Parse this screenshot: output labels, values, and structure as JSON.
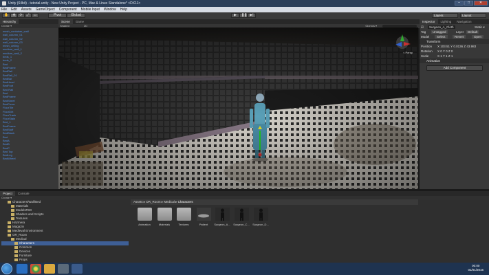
{
  "window": {
    "title": "Unity (64bit) - tutorial.unity - New Unity Project - PC, Mac & Linux Standalone* <DX11>",
    "controls": [
      "–",
      "□",
      "✕"
    ]
  },
  "menu": [
    "File",
    "Edit",
    "Assets",
    "GameObject",
    "Component",
    "Mobile Input",
    "Window",
    "Help"
  ],
  "toolbar": {
    "tools": [
      "✋",
      "✥",
      "⟳",
      "⤢",
      "▭"
    ],
    "pivot": "Pivot",
    "space": "Global",
    "play": "▶",
    "pause": "❚❚",
    "step": "▶|",
    "layers": "Layers",
    "layout": "Layout"
  },
  "hierarchy": {
    "tab": "Hierarchy",
    "create": "Create ▾",
    "items": [
      "mesh_container_wall",
      "wall_column_01",
      "wall_column_02",
      "wall_column_03",
      "mesh_ceiling",
      "medium_wall_1",
      "medium_wall_2",
      "beds_1",
      "beds_2",
      "Bed",
      "BedFrame",
      "BedRail",
      "BedRail_01",
      "BedBar",
      "BedHead",
      "BedFoot",
      "Bed Rail",
      "Bed",
      "BedFrame",
      "BedSheet",
      "BedCover",
      "FloorTile",
      "FloorDirt",
      "FloorTrash",
      "FloorStain",
      "Bed_1",
      "BedFrame",
      "BedStuff",
      "BedBlank",
      "Bed",
      "BedA",
      "BedB",
      "BedC",
      "Bed Top",
      "BedLeg",
      "BedWheel"
    ]
  },
  "scene": {
    "tabs": [
      "Scene",
      "Game"
    ],
    "shading": "Shaded",
    "mode": "2D",
    "gizmos": "Gizmos ▾",
    "persp": "< Persp"
  },
  "inspector": {
    "tabs": [
      "Inspector",
      "Lighting",
      "Navigation"
    ],
    "object_name": "Surgeon_A_Cloth",
    "static": "Static ▾",
    "tag_label": "Tag",
    "tag_value": "Untagged",
    "layer_label": "Layer",
    "layer_value": "Default",
    "model_label": "Model",
    "model_buttons": [
      "Select",
      "Revert",
      "Open"
    ],
    "transform": "Transform",
    "position_label": "Position",
    "position": "X 103.51  Y 0.0136  Z 43.983",
    "rotation_label": "Rotation",
    "rotation": "X 0      Y 0        Z 0",
    "scale_label": "Scale",
    "scale": "X 1      Y 1        Z 1",
    "animation": "Animation",
    "add_component": "Add Component"
  },
  "project": {
    "tabs": [
      "Project",
      "Console"
    ],
    "create": "Create ▾",
    "tree": [
      {
        "label": "Characters/Wall/Bed",
        "indent": 1
      },
      {
        "label": "Materials",
        "indent": 2
      },
      {
        "label": "ModelsFBX",
        "indent": 2
      },
      {
        "label": "Shaders and Scripts",
        "indent": 2
      },
      {
        "label": "Textures",
        "indent": 2
      },
      {
        "label": "Hazmera",
        "indent": 1
      },
      {
        "label": "Magazin",
        "indent": 1
      },
      {
        "label": "Medieval Environment",
        "indent": 1
      },
      {
        "label": "OR_Room",
        "indent": 1
      },
      {
        "label": "Medical",
        "indent": 2
      },
      {
        "label": "Characters",
        "indent": 3,
        "selected": true
      },
      {
        "label": "Common",
        "indent": 3
      },
      {
        "label": "Devices",
        "indent": 3
      },
      {
        "label": "Furniture",
        "indent": 3
      },
      {
        "label": "Props",
        "indent": 3
      }
    ],
    "breadcrumb": [
      "Assets",
      "OR_Room",
      "Medical",
      "Characters"
    ],
    "assets": [
      {
        "label": "Animation",
        "kind": "folder"
      },
      {
        "label": "Materials",
        "kind": "folder"
      },
      {
        "label": "Textures",
        "kind": "folder"
      },
      {
        "label": "Patient",
        "kind": "model"
      },
      {
        "label": "Surgeon_A...",
        "kind": "figure"
      },
      {
        "label": "Surgeon_C...",
        "kind": "figure"
      },
      {
        "label": "Surgeon_D...",
        "kind": "figure"
      }
    ]
  },
  "taskbar": {
    "time": "00:00",
    "date": "01/01/2016"
  }
}
